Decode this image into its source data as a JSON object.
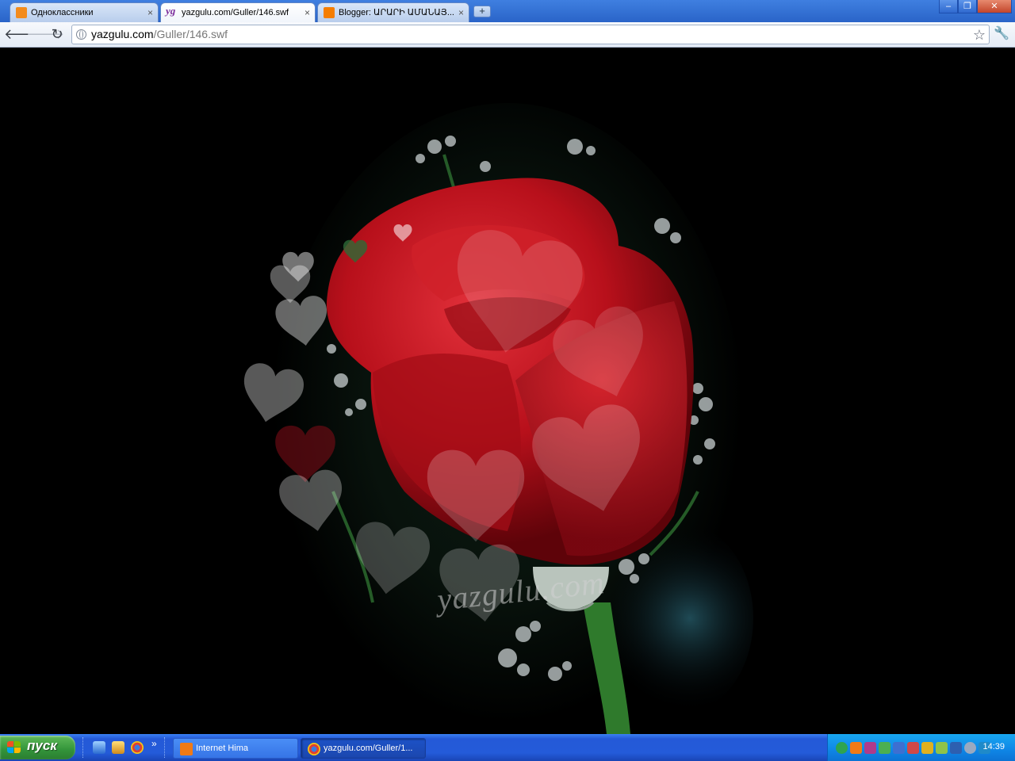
{
  "browser": {
    "tabs": [
      {
        "label": "Одноклассники",
        "icon": "odnoklassniki-icon",
        "active": false
      },
      {
        "label": "yazgulu.com/Guller/146.swf",
        "icon": "yazgulu-icon",
        "icon_text": "yg",
        "active": true
      },
      {
        "label": "Blogger: ԱՐԱՐԻ ԱՄԱՆԱՅ...",
        "icon": "blogger-icon",
        "active": false
      }
    ],
    "tab_close_glyph": "×",
    "new_tab_glyph": "+",
    "window_controls": {
      "minimize": "–",
      "maximize": "❐",
      "close": "✕"
    },
    "toolbar": {
      "back_glyph": "🡐",
      "forward_glyph": "🡒",
      "reload_glyph": "↻",
      "url_host": "yazgulu.com",
      "url_path": "/Guller/146.swf",
      "star_glyph": "☆",
      "wrench_glyph": "🔧"
    }
  },
  "content": {
    "watermark": "yazgulu.com"
  },
  "taskbar": {
    "start_label": "пуск",
    "quicklaunch_more": "»",
    "tasks": [
      {
        "label": "Internet Hima",
        "icon": "internet-hima-icon"
      },
      {
        "label": "yazgulu.com/Guller/1...",
        "icon": "chrome-icon"
      }
    ],
    "clock": "14:39"
  },
  "colors": {
    "taskbar_blue": "#245bd9",
    "start_green": "#33943a",
    "tray_blue": "#0f86e6",
    "rose_red": "#c0141e"
  }
}
